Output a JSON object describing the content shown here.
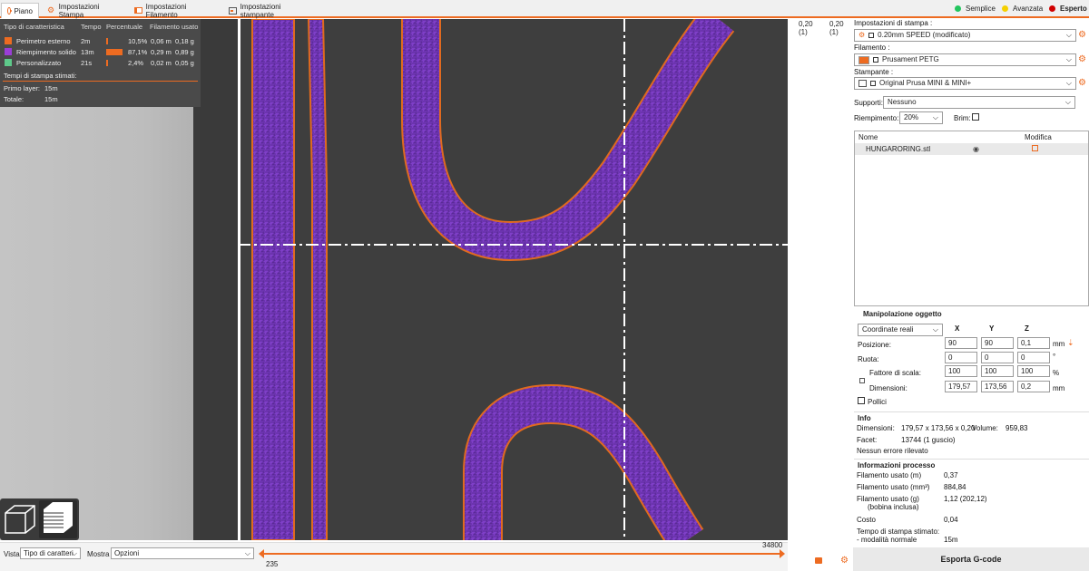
{
  "tabs": [
    {
      "label": "Piano",
      "icon": "plater-icon",
      "active": true
    },
    {
      "label": "Impostazioni Stampa",
      "icon": "cog-icon",
      "active": false
    },
    {
      "label": "Impostazioni Filamento",
      "icon": "spool-icon",
      "active": false
    },
    {
      "label": "Impostazioni stampante",
      "icon": "printer-icon",
      "active": false
    }
  ],
  "modes": [
    {
      "label": "Semplice",
      "color": "#22c55e"
    },
    {
      "label": "Avanzata",
      "color": "#f5d000"
    },
    {
      "label": "Esperto",
      "color": "#d00000",
      "bold": true
    }
  ],
  "stats": {
    "headers": {
      "feature": "Tipo di caratteristica",
      "time": "Tempo",
      "percent": "Percentuale",
      "filament": "Filamento usato"
    },
    "rows": [
      {
        "name": "Perimetro esterno",
        "time": "2m",
        "percent": "10,5%",
        "fraction": 0.105,
        "length": "0,06 m",
        "weight": "0,18 g",
        "color": "#ed6b21"
      },
      {
        "name": "Riempimento solido",
        "time": "13m",
        "percent": "87,1%",
        "fraction": 0.871,
        "length": "0,29 m",
        "weight": "0,89 g",
        "color": "#9a3ed6"
      },
      {
        "name": "Personalizzato",
        "time": "21s",
        "percent": "2,4%",
        "fraction": 0.024,
        "length": "0,02 m",
        "weight": "0,05 g",
        "color": "#5ec98a"
      }
    ],
    "time_title": "Tempi di stampa stimati:",
    "first_layer_label": "Primo layer:",
    "first_layer_value": "15m",
    "total_label": "Totale:",
    "total_value": "15m"
  },
  "vslider": {
    "top_left": "0,20",
    "top_left_sub": "(1)",
    "top_right": "0,20",
    "top_right_sub": "(1)"
  },
  "hslider": {
    "right_value": "34800",
    "left_value": "235"
  },
  "bottom": {
    "view_label": "Vista",
    "view_value": "Tipo di caratteri",
    "show_label": "Mostra",
    "show_value": "Opzioni"
  },
  "right": {
    "print_settings_label": "Impostazioni di stampa :",
    "print_settings_value": "0.20mm SPEED (modificato)",
    "filament_label": "Filamento :",
    "filament_value": "Prusament PETG",
    "filament_color": "#ed6b21",
    "printer_label": "Stampante :",
    "printer_value": "Original Prusa MINI & MINI+",
    "supports_label": "Supporti:",
    "supports_value": "Nessuno",
    "infill_label": "Riempimento:",
    "infill_value": "20%",
    "brim_label": "Brim:",
    "objects_col_name": "Nome",
    "objects_col_edit": "Modifica",
    "object_name": "HUNGARORING.stl",
    "manip_title": "Manipolazione oggetto",
    "coord_value": "Coordinate reali",
    "axis_x": "X",
    "axis_y": "Y",
    "axis_z": "Z",
    "position_label": "Posizione:",
    "position": [
      "90",
      "90",
      "0,1"
    ],
    "position_unit": "mm",
    "rotate_label": "Ruota:",
    "rotate": [
      "0",
      "0",
      "0"
    ],
    "rotate_unit": "°",
    "scale_label": "Fattore di scala:",
    "scale": [
      "100",
      "100",
      "100"
    ],
    "scale_unit": "%",
    "size_label": "Dimensioni:",
    "size": [
      "179,57",
      "173,56",
      "0,2"
    ],
    "size_unit": "mm",
    "inches_label": "Pollici",
    "info_title": "Info",
    "info_dims_label": "Dimensioni:",
    "info_dims_value": "179,57 x 173,56 x 0,20",
    "info_volume_label": "Volume:",
    "info_volume_value": "959,83",
    "info_facets_label": "Facet:",
    "info_facets_value": "13744 (1 guscio)",
    "info_errors": "Nessun errore rilevato",
    "proc_title": "Informazioni processo",
    "proc_rows": [
      {
        "label": "Filamento usato (m)",
        "value": "0,37"
      },
      {
        "label": "Filamento usato (mm³)",
        "value": "884,84"
      },
      {
        "label": "Filamento usato (g)",
        "value": "1,12 (202,12)"
      },
      {
        "label": "(bobina inclusa)",
        "value": ""
      },
      {
        "label": "Costo",
        "value": "0,04"
      },
      {
        "label": "Tempo di stampa stimato:",
        "value": ""
      },
      {
        "label": " - modalità normale",
        "value": "15m"
      }
    ],
    "export_label": "Esporta G-code"
  }
}
